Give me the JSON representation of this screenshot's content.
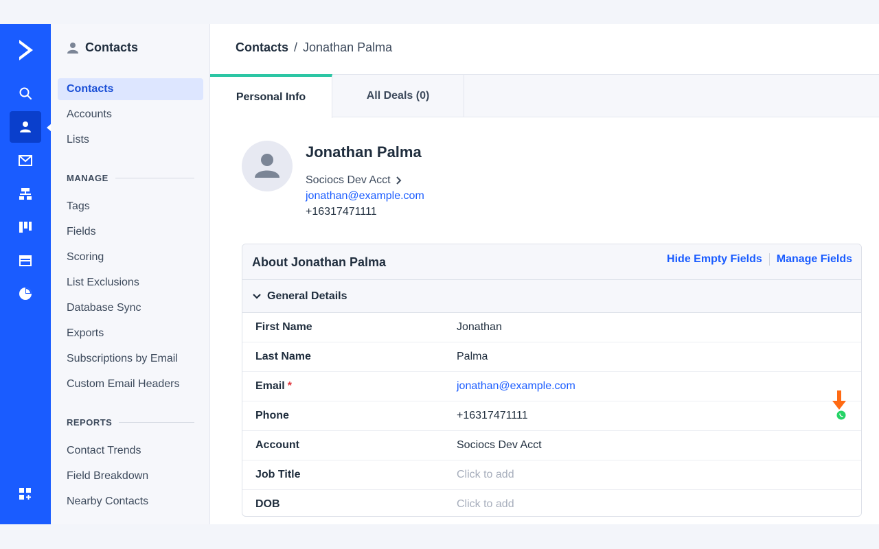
{
  "subnav": {
    "title": "Contacts",
    "items": [
      {
        "label": "Contacts"
      },
      {
        "label": "Accounts"
      },
      {
        "label": "Lists"
      }
    ],
    "manage_label": "MANAGE",
    "manage_items": [
      {
        "label": "Tags"
      },
      {
        "label": "Fields"
      },
      {
        "label": "Scoring"
      },
      {
        "label": "List Exclusions"
      },
      {
        "label": "Database Sync"
      },
      {
        "label": "Exports"
      },
      {
        "label": "Subscriptions by Email"
      },
      {
        "label": "Custom Email Headers"
      }
    ],
    "reports_label": "REPORTS",
    "reports_items": [
      {
        "label": "Contact Trends"
      },
      {
        "label": "Field Breakdown"
      },
      {
        "label": "Nearby Contacts"
      }
    ]
  },
  "breadcrumb": {
    "root": "Contacts",
    "separator": "/",
    "current": "Jonathan Palma"
  },
  "tabs": [
    {
      "label": "Personal Info"
    },
    {
      "label": "All Deals (0)"
    }
  ],
  "profile": {
    "name": "Jonathan Palma",
    "account": "Sociocs Dev Acct",
    "email": "jonathan@example.com",
    "phone": "+16317471111"
  },
  "about": {
    "title": "About Jonathan Palma",
    "hide_empty": "Hide Empty Fields",
    "manage_fields": "Manage Fields",
    "section": "General Details",
    "fields": [
      {
        "label": "First Name",
        "value": "Jonathan"
      },
      {
        "label": "Last Name",
        "value": "Palma"
      },
      {
        "label": "Email",
        "value": "jonathan@example.com",
        "required": "*"
      },
      {
        "label": "Phone",
        "value": "+16317471111"
      },
      {
        "label": "Account",
        "value": "Sociocs Dev Acct"
      },
      {
        "label": "Job Title",
        "value": "Click to add"
      },
      {
        "label": "DOB",
        "value": "Click to add"
      }
    ]
  },
  "colors": {
    "rail": "#1a5cff",
    "accent_link": "#1a5cff",
    "tab_active": "#2cc6a4",
    "annotation_arrow": "#ff6a13",
    "whatsapp": "#25d366"
  }
}
